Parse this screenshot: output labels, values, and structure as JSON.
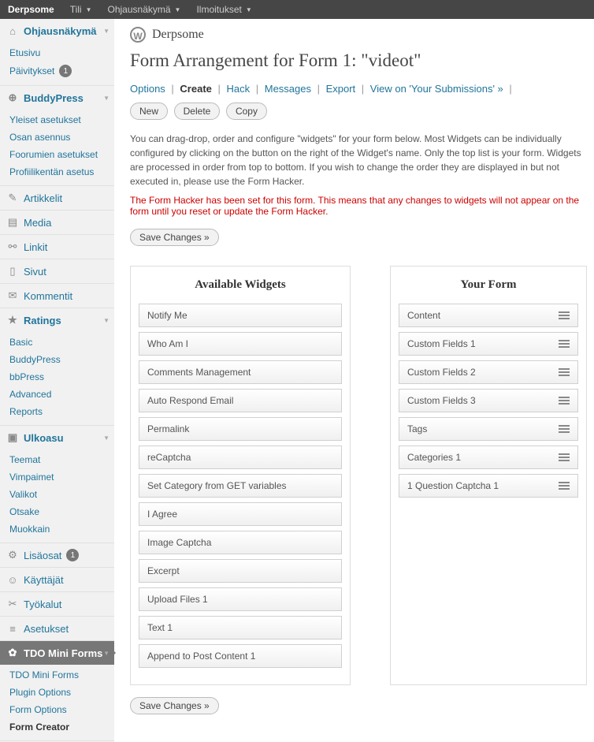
{
  "adminBar": {
    "site": "Derpsome",
    "items": [
      "Tili",
      "Ohjausnäkymä",
      "Ilmoitukset"
    ]
  },
  "sidebar": [
    {
      "label": "Ohjausnäkymä",
      "icon": "⌂",
      "open": true,
      "sub": [
        {
          "label": "Etusivu"
        },
        {
          "label": "Päivitykset",
          "badge": "1"
        }
      ]
    },
    {
      "label": "BuddyPress",
      "icon": "⊕",
      "open": true,
      "sub": [
        {
          "label": "Yleiset asetukset"
        },
        {
          "label": "Osan asennus"
        },
        {
          "label": "Foorumien asetukset"
        },
        {
          "label": "Profiilikentän asetus"
        }
      ]
    },
    {
      "label": "Artikkelit",
      "icon": "✎"
    },
    {
      "label": "Media",
      "icon": "▤"
    },
    {
      "label": "Linkit",
      "icon": "⚯"
    },
    {
      "label": "Sivut",
      "icon": "▯"
    },
    {
      "label": "Kommentit",
      "icon": "✉"
    },
    {
      "label": "Ratings",
      "icon": "★",
      "open": true,
      "sub": [
        {
          "label": "Basic"
        },
        {
          "label": "BuddyPress"
        },
        {
          "label": "bbPress"
        },
        {
          "label": "Advanced"
        },
        {
          "label": "Reports"
        }
      ]
    },
    {
      "label": "Ulkoasu",
      "icon": "▣",
      "open": true,
      "sub": [
        {
          "label": "Teemat"
        },
        {
          "label": "Vimpaimet"
        },
        {
          "label": "Valikot"
        },
        {
          "label": "Otsake"
        },
        {
          "label": "Muokkain"
        }
      ]
    },
    {
      "label": "Lisäosat",
      "icon": "⚙",
      "badge": "1"
    },
    {
      "label": "Käyttäjät",
      "icon": "☺"
    },
    {
      "label": "Työkalut",
      "icon": "✂"
    },
    {
      "label": "Asetukset",
      "icon": "≡"
    },
    {
      "label": "TDO Mini Forms",
      "icon": "✿",
      "current": true,
      "open": true,
      "sub": [
        {
          "label": "TDO Mini Forms"
        },
        {
          "label": "Plugin Options"
        },
        {
          "label": "Form Options"
        },
        {
          "label": "Form Creator",
          "current": true
        }
      ]
    }
  ],
  "header": {
    "siteName": "Derpsome"
  },
  "page": {
    "title": "Form Arrangement for Form 1: \"videot\"",
    "tabs": [
      "Options",
      "Create",
      "Hack",
      "Messages",
      "Export",
      "View on 'Your Submissions' »"
    ],
    "activeTab": "Create",
    "actions": {
      "new": "New",
      "delete": "Delete",
      "copy": "Copy"
    },
    "help": "You can drag-drop, order and configure \"widgets\" for your form below. Most Widgets can be individually configured by clicking on the button on the right of the Widget's name. Only the top list is your form. Widgets are processed in order from top to bottom. If you wish to change the order they are displayed in but not executed in, please use the Form Hacker.",
    "warning": "The Form Hacker has been set for this form. This means that any changes to widgets will not appear on the form until you reset or update the Form Hacker.",
    "save": "Save Changes »"
  },
  "available": {
    "title": "Available Widgets",
    "items": [
      "Notify Me",
      "Who Am I",
      "Comments Management",
      "Auto Respond Email",
      "Permalink",
      "reCaptcha",
      "Set Category from GET variables",
      "I Agree",
      "Image Captcha",
      "Excerpt",
      "Upload Files 1",
      "Text 1",
      "Append to Post Content 1"
    ]
  },
  "yourForm": {
    "title": "Your Form",
    "items": [
      "Content",
      "Custom Fields 1",
      "Custom Fields 2",
      "Custom Fields 3",
      "Tags",
      "Categories 1",
      "1 Question Captcha 1"
    ]
  }
}
